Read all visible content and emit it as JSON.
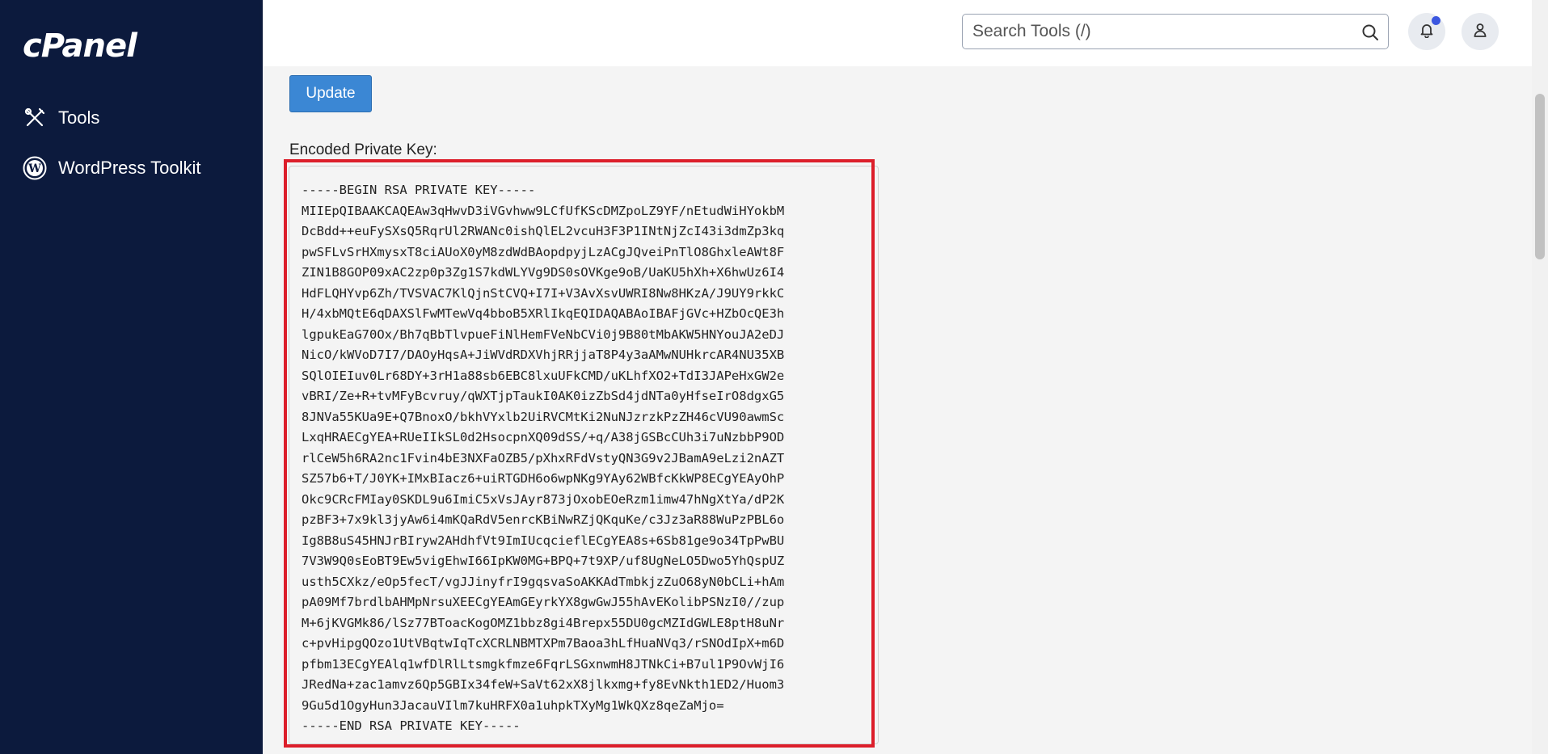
{
  "sidebar": {
    "brand": "cPanel",
    "items": [
      {
        "label": "Tools",
        "icon": "tools-icon"
      },
      {
        "label": "WordPress Toolkit",
        "icon": "wordpress-icon"
      }
    ]
  },
  "header": {
    "search_placeholder": "Search Tools (/)",
    "search_value": ""
  },
  "main": {
    "update_label": "Update",
    "key_label": "Encoded Private Key:",
    "key_lines": [
      "-----BEGIN RSA PRIVATE KEY-----",
      "MIIEpQIBAAKCAQEAw3qHwvD3iVGvhww9LCfUfKScDMZpoLZ9YF/nEtudWiHYokbM",
      "DcBdd++euFySXsQ5RqrUl2RWANc0ishQlEL2vcuH3F3P1INtNjZcI43i3dmZp3kq",
      "pwSFLvSrHXmysxT8ciAUoX0yM8zdWdBAopdpyjLzACgJQveiPnTlO8GhxleAWt8F",
      "ZIN1B8GOP09xAC2zp0p3Zg1S7kdWLYVg9DS0sOVKge9oB/UaKU5hXh+X6hwUz6I4",
      "HdFLQHYvp6Zh/TVSVAC7KlQjnStCVQ+I7I+V3AvXsvUWRI8Nw8HKzA/J9UY9rkkC",
      "H/4xbMQtE6qDAXSlFwMTewVq4bboB5XRlIkqEQIDAQABAoIBAFjGVc+HZbOcQE3h",
      "lgpukEaG70Ox/Bh7qBbTlvpueFiNlHemFVeNbCVi0j9B80tMbAKW5HNYouJA2eDJ",
      "NicO/kWVoD7I7/DAOyHqsA+JiWVdRDXVhjRRjjaT8P4y3aAMwNUHkrcAR4NU35XB",
      "SQlOIEIuv0Lr68DY+3rH1a88sb6EBC8lxuUFkCMD/uKLhfXO2+TdI3JAPeHxGW2e",
      "vBRI/Ze+R+tvMFyBcvruy/qWXTjpTaukI0AK0izZbSd4jdNTa0yHfseIrO8dgxG5",
      "8JNVa55KUa9E+Q7BnoxO/bkhVYxlb2UiRVCMtKi2NuNJzrzkPzZH46cVU90awmSc",
      "LxqHRAECgYEA+RUeIIkSL0d2HsocpnXQ09dSS/+q/A38jGSBcCUh3i7uNzbbP9OD",
      "rlCeW5h6RA2nc1Fvin4bE3NXFaOZB5/pXhxRFdVstyQN3G9v2JBamA9eLzi2nAZT",
      "SZ57b6+T/J0YK+IMxBIacz6+uiRTGDH6o6wpNKg9YAy62WBfcKkWP8ECgYEAyOhP",
      "Okc9CRcFMIay0SKDL9u6ImiC5xVsJAyr873jOxobEOeRzm1imw47hNgXtYa/dP2K",
      "pzBF3+7x9kl3jyAw6i4mKQaRdV5enrcKBiNwRZjQKquKe/c3Jz3aR88WuPzPBL6o",
      "Ig8B8uS45HNJrBIryw2AHdhfVt9ImIUcqcieflECgYEA8s+6Sb81ge9o34TpPwBU",
      "7V3W9Q0sEoBT9Ew5vigEhwI66IpKW0MG+BPQ+7t9XP/uf8UgNeLO5Dwo5YhQspUZ",
      "usth5CXkz/eOp5fecT/vgJJinyfrI9gqsvaSoAKKAdTmbkjzZuO68yN0bCLi+hAm",
      "pA09Mf7brdlbAHMpNrsuXEECgYEAmGEyrkYX8gwGwJ55hAvEKolibPSNzI0//zup",
      "M+6jKVGMk86/lSz77BToacKogOMZ1bbz8gi4Brepx55DU0gcMZIdGWLE8ptH8uNr",
      "c+pvHipgQOzo1UtVBqtwIqTcXCRLNBMTXPm7Baoa3hLfHuaNVq3/rSNOdIpX+m6D",
      "pfbm13ECgYEAlq1wfDlRlLtsmgkfmze6FqrLSGxnwmH8JTNkCi+B7ul1P9OvWjI6",
      "JRedNa+zac1amvz6Qp5GBIx34feW+SaVt62xX8jlkxmg+fy8EvNkth1ED2/Huom3",
      "9Gu5d1OgyHun3JacauVIlm7kuHRFX0a1uhpkTXyMg1WkQXz8qeZaMjo=",
      "-----END RSA PRIVATE KEY-----"
    ]
  },
  "colors": {
    "sidebar_bg": "#0c1a3d",
    "accent_button": "#3b87d4",
    "highlight_border": "#dc1e2a",
    "notification_dot": "#3b57e0"
  }
}
